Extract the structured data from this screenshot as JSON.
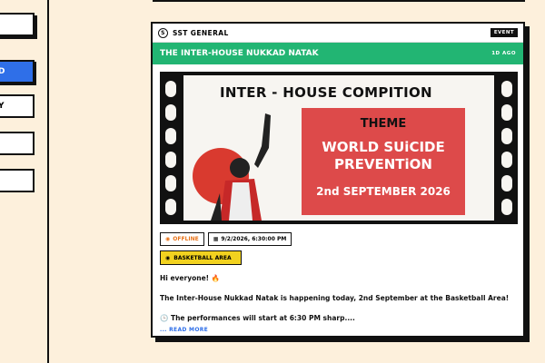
{
  "sidebar": {
    "items": [
      {
        "label": ""
      },
      {
        "label": "D"
      },
      {
        "label": "Y"
      },
      {
        "label": ""
      },
      {
        "label": ""
      }
    ]
  },
  "card": {
    "channel": "SST GENERAL",
    "channel_logo": "S",
    "type_badge": "EVENT",
    "title": "THE INTER-HOUSE NUKKAD NATAK",
    "time_ago": "1D AGO",
    "poster": {
      "heading": "INTER - HOUSE COMPITION",
      "theme_label": "THEME",
      "theme_title_1": "WORLD SUiCIDE",
      "theme_title_2": "PREVENTiON",
      "date": "2nd SEPTEMBER 2026"
    },
    "mode": "OFFLINE",
    "datetime": "9/2/2026, 6:30:00 PM",
    "location": "BASKETBALL AREA",
    "greeting": "Hi everyone! 🔥",
    "line1": "The Inter-House Nukkad Natak is happening today, 2nd September at the Basketball Area!",
    "line2": "🕒 The performances will start at 6:30 PM sharp....",
    "read_more": "... READ MORE"
  },
  "colors": {
    "accent_green": "#22b573",
    "accent_blue": "#2f6fe8",
    "poster_red": "#dd4a4a",
    "chip_yellow": "#f2d21f"
  }
}
